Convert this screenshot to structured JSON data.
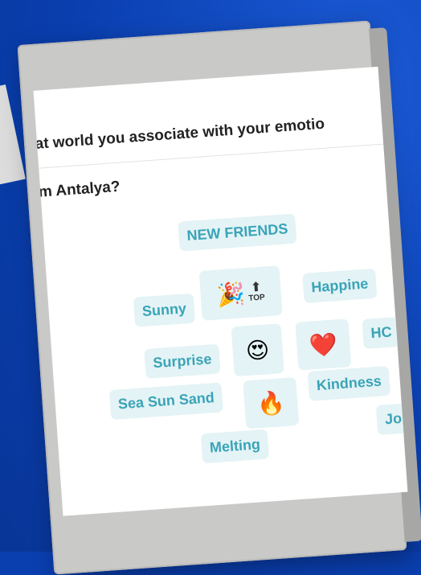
{
  "question": {
    "line1": "hat world you associate with your emotio",
    "line2": "om Antalya?"
  },
  "chips": {
    "new_friends": "NEW FRIENDS",
    "sunny": "Sunny",
    "happiness": "Happine",
    "surprise": "Surprise",
    "hot": "HC",
    "sea_sun_sand": "Sea Sun Sand",
    "kindness": "Kindness",
    "melting": "Melting",
    "joy": "Jo"
  },
  "emojis": {
    "party": "🎉",
    "top_arrow": "⬆",
    "top_text": "TOP",
    "heart_eyes": "😍",
    "heart": "❤️",
    "fire": "🔥"
  }
}
